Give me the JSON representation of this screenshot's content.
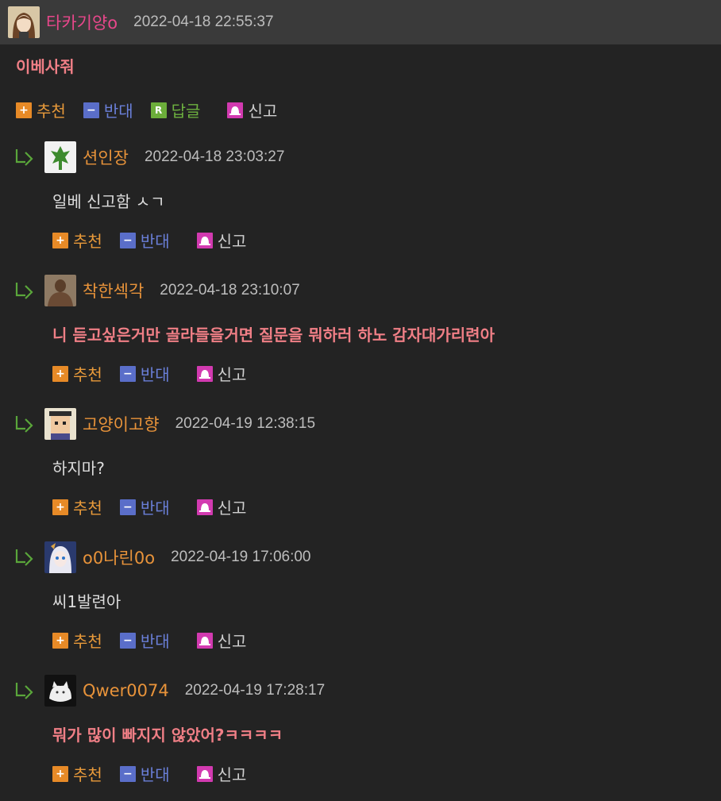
{
  "post": {
    "author": "타카기양o",
    "time": "2022-04-18 22:55:37",
    "body": "이베사줘",
    "actions": {
      "up": "추천",
      "down": "반대",
      "reply": "답글",
      "report": "신고"
    }
  },
  "replies": [
    {
      "author": "션인장",
      "time": "2022-04-18 23:03:27",
      "body": "일베 신고함 ㅅㄱ",
      "bold": false
    },
    {
      "author": "착한섹각",
      "time": "2022-04-18 23:10:07",
      "body": "니 듣고싶은거만 골라들을거면 질문을 뭐하러 하노 감자대가리련아",
      "bold": true
    },
    {
      "author": "고양이고향",
      "time": "2022-04-19 12:38:15",
      "body": "하지마?",
      "bold": false
    },
    {
      "author": "o0나린0o",
      "time": "2022-04-19 17:06:00",
      "body": "씨1발련아",
      "bold": false
    },
    {
      "author": "Qwer0074",
      "time": "2022-04-19 17:28:17",
      "body": "뭐가 많이 빠지지 않았어?ㅋㅋㅋㅋ",
      "bold": true
    }
  ],
  "reply_actions": {
    "up": "추천",
    "down": "반대",
    "report": "신고"
  },
  "icons": {
    "up": "plus-icon",
    "down": "minus-icon",
    "reply": "r-icon",
    "report": "alarm-icon",
    "reply_arrow": "reply-arrow-icon"
  },
  "colors": {
    "background": "#232323",
    "topbar": "#3a3a3a",
    "top_author": "#e8478b",
    "reply_author": "#e8933a",
    "highlight_text": "#f07f86",
    "up": "#e78a27",
    "down": "#5a6ec9",
    "reply": "#6cae3a",
    "report": "#d23ab0"
  }
}
